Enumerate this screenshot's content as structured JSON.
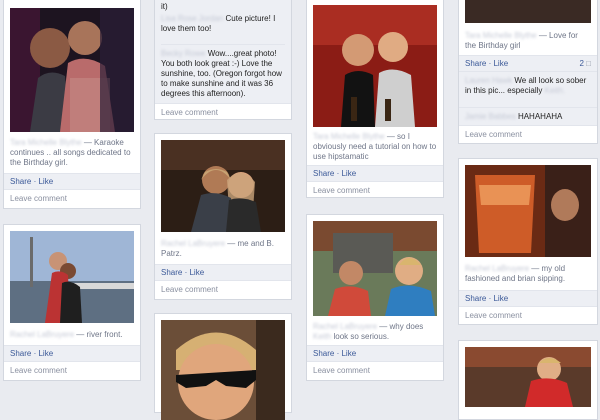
{
  "cards": {
    "c1": {
      "name": "Tara Michelle Blythe",
      "caption": "— Karaoke continues .. all songs dedicated to the Birthday girl.",
      "share": "Share",
      "like": "Like",
      "leave_comment": "Leave comment"
    },
    "c2": {
      "name": "Rachel LaBruyere",
      "caption": "— river front.",
      "share": "Share",
      "like": "Like",
      "leave_comment": "Leave comment"
    },
    "c3": {
      "top_text": "it)",
      "comment1_name": "Lisa Rose Jordan",
      "comment1_text": "Cute picture! I love them too!",
      "comment2_name": "Becky Rowe",
      "comment2_text": "Wow....great photo! You both look great :-) Love the sunshine, too. (Oregon forgot how to make sunshine and it was 36 degrees this afternoon).",
      "leave_comment": "Leave comment"
    },
    "c4": {
      "name": "Rachel LaBruyere",
      "caption": "— me and B. Patrz.",
      "share": "Share",
      "like": "Like",
      "leave_comment": "Leave comment"
    },
    "c6": {
      "name": "Tara Michelle Blythe",
      "caption": "— so I obviously need a tutorial on how to use hipstamatic",
      "share": "Share",
      "like": "Like",
      "leave_comment": "Leave comment"
    },
    "c7": {
      "name": "Rachel LaBruyere",
      "caption": "— why does",
      "caption2_name": "Keith",
      "caption2": "look so serious.",
      "share": "Share",
      "like": "Like",
      "leave_comment": "Leave comment"
    },
    "c8": {
      "name": "Tara Michelle Blythe",
      "caption": "— Love for the Birthday girl",
      "share": "Share",
      "like": "Like",
      "comment_count": "2",
      "comment1_name": "Lauren Hawk",
      "comment1_text": "We all look so sober in this pic... especially",
      "comment1_tail": "Keith.",
      "comment2_name": "Jamie Babbes",
      "comment2_text": "HAHAHAHA",
      "leave_comment": "Leave comment"
    },
    "c9": {
      "name": "Rachel LaBruyere",
      "caption": "— my old fashioned and brian sipping.",
      "share": "Share",
      "like": "Like",
      "leave_comment": "Leave comment"
    }
  },
  "colors": {
    "link": "#3b5998",
    "page_bg": "#e9ebf0",
    "muted": "#6f7688"
  }
}
